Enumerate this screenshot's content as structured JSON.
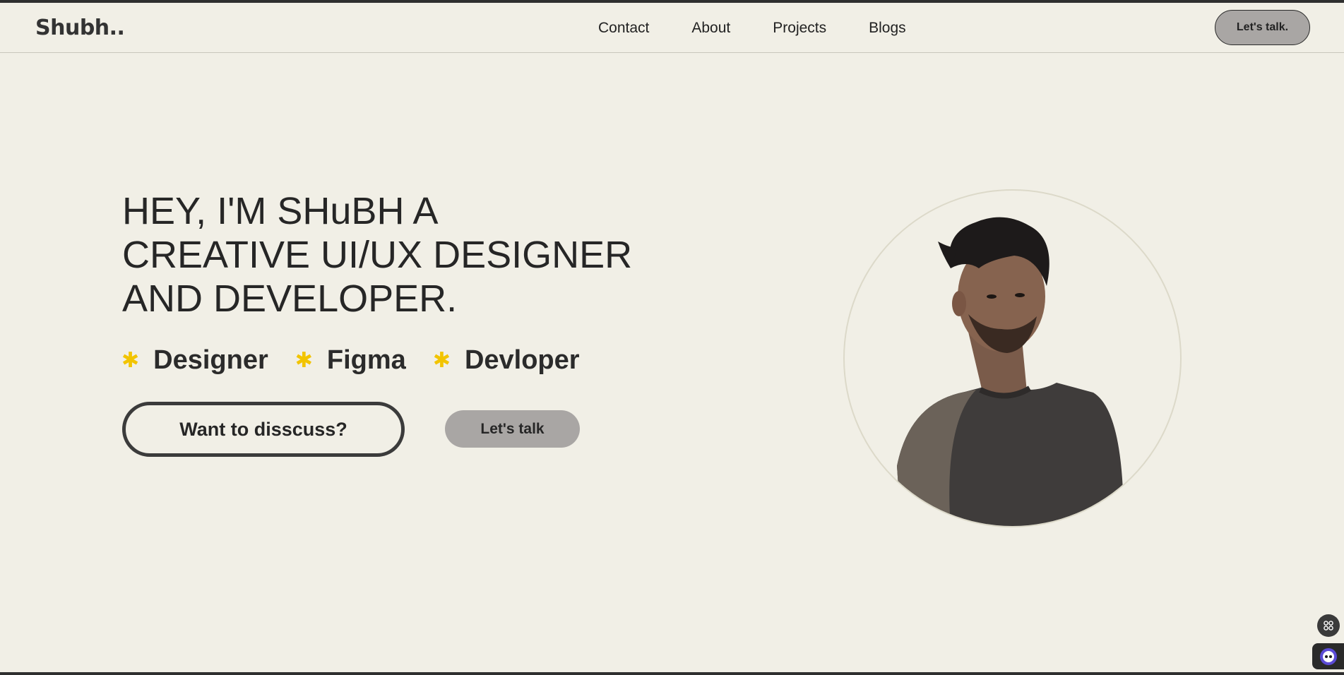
{
  "header": {
    "logo": "Shubh..",
    "nav": [
      "Contact",
      "About",
      "Projects",
      "Blogs"
    ],
    "cta_label": "Let's talk."
  },
  "hero": {
    "title_lines": [
      "HEY, I'M SHuBH A",
      "CREATIVE UI/UX DESIGNER",
      "AND DEVELOPER."
    ],
    "skills": [
      "Designer",
      "Figma",
      "Devloper"
    ],
    "primary_button": "Want to disscuss?",
    "secondary_button": "Let's talk"
  },
  "colors": {
    "background": "#f1efe6",
    "accent_star": "#f2c400",
    "button_gray": "#a9a6a4",
    "text": "#262626"
  },
  "icons": {
    "skill_marker": "asterisk-icon",
    "floating_top": "apps-icon",
    "floating_bottom": "chatbot-icon"
  }
}
